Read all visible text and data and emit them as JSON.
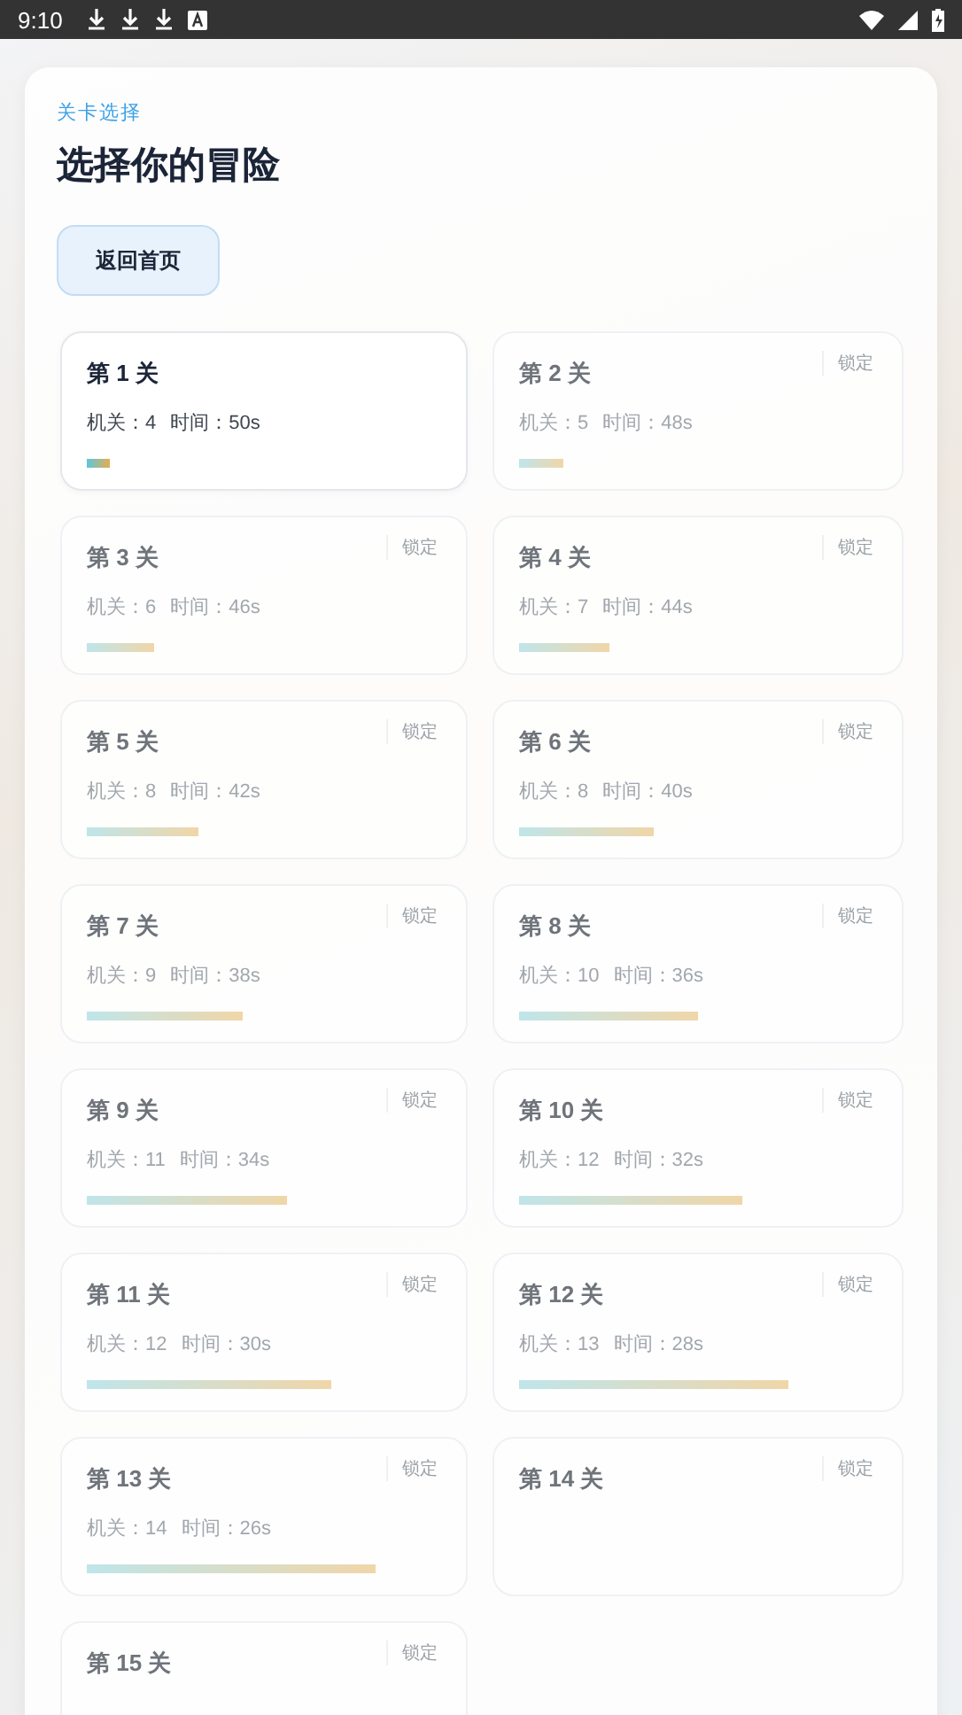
{
  "status_bar": {
    "time": "9:10"
  },
  "header": {
    "eyebrow": "关卡选择",
    "title": "选择你的冒险"
  },
  "back_button": {
    "label": "返回首页"
  },
  "levels": [
    {
      "title": "第 1 关",
      "locked": false,
      "traps": "机关：4",
      "time": "时间：50s"
    },
    {
      "title": "第 2 关",
      "locked": true,
      "lock_label": "锁定",
      "traps": "机关：5",
      "time": "时间：48s"
    },
    {
      "title": "第 3 关",
      "locked": true,
      "lock_label": "锁定",
      "traps": "机关：6",
      "time": "时间：46s"
    },
    {
      "title": "第 4 关",
      "locked": true,
      "lock_label": "锁定",
      "traps": "机关：7",
      "time": "时间：44s"
    },
    {
      "title": "第 5 关",
      "locked": true,
      "lock_label": "锁定",
      "traps": "机关：8",
      "time": "时间：42s"
    },
    {
      "title": "第 6 关",
      "locked": true,
      "lock_label": "锁定",
      "traps": "机关：8",
      "time": "时间：40s"
    },
    {
      "title": "第 7 关",
      "locked": true,
      "lock_label": "锁定",
      "traps": "机关：9",
      "time": "时间：38s"
    },
    {
      "title": "第 8 关",
      "locked": true,
      "lock_label": "锁定",
      "traps": "机关：10",
      "time": "时间：36s"
    },
    {
      "title": "第 9 关",
      "locked": true,
      "lock_label": "锁定",
      "traps": "机关：11",
      "time": "时间：34s"
    },
    {
      "title": "第 10 关",
      "locked": true,
      "lock_label": "锁定",
      "traps": "机关：12",
      "time": "时间：32s"
    },
    {
      "title": "第 11 关",
      "locked": true,
      "lock_label": "锁定",
      "traps": "机关：12",
      "time": "时间：30s"
    },
    {
      "title": "第 12 关",
      "locked": true,
      "lock_label": "锁定",
      "traps": "机关：13",
      "time": "时间：28s"
    },
    {
      "title": "第 13 关",
      "locked": true,
      "lock_label": "锁定",
      "traps": "机关：14",
      "time": "时间：26s"
    },
    {
      "title": "第 14 关",
      "locked": true,
      "lock_label": "锁定"
    },
    {
      "title": "第 15 关",
      "locked": true,
      "lock_label": "锁定"
    }
  ]
}
